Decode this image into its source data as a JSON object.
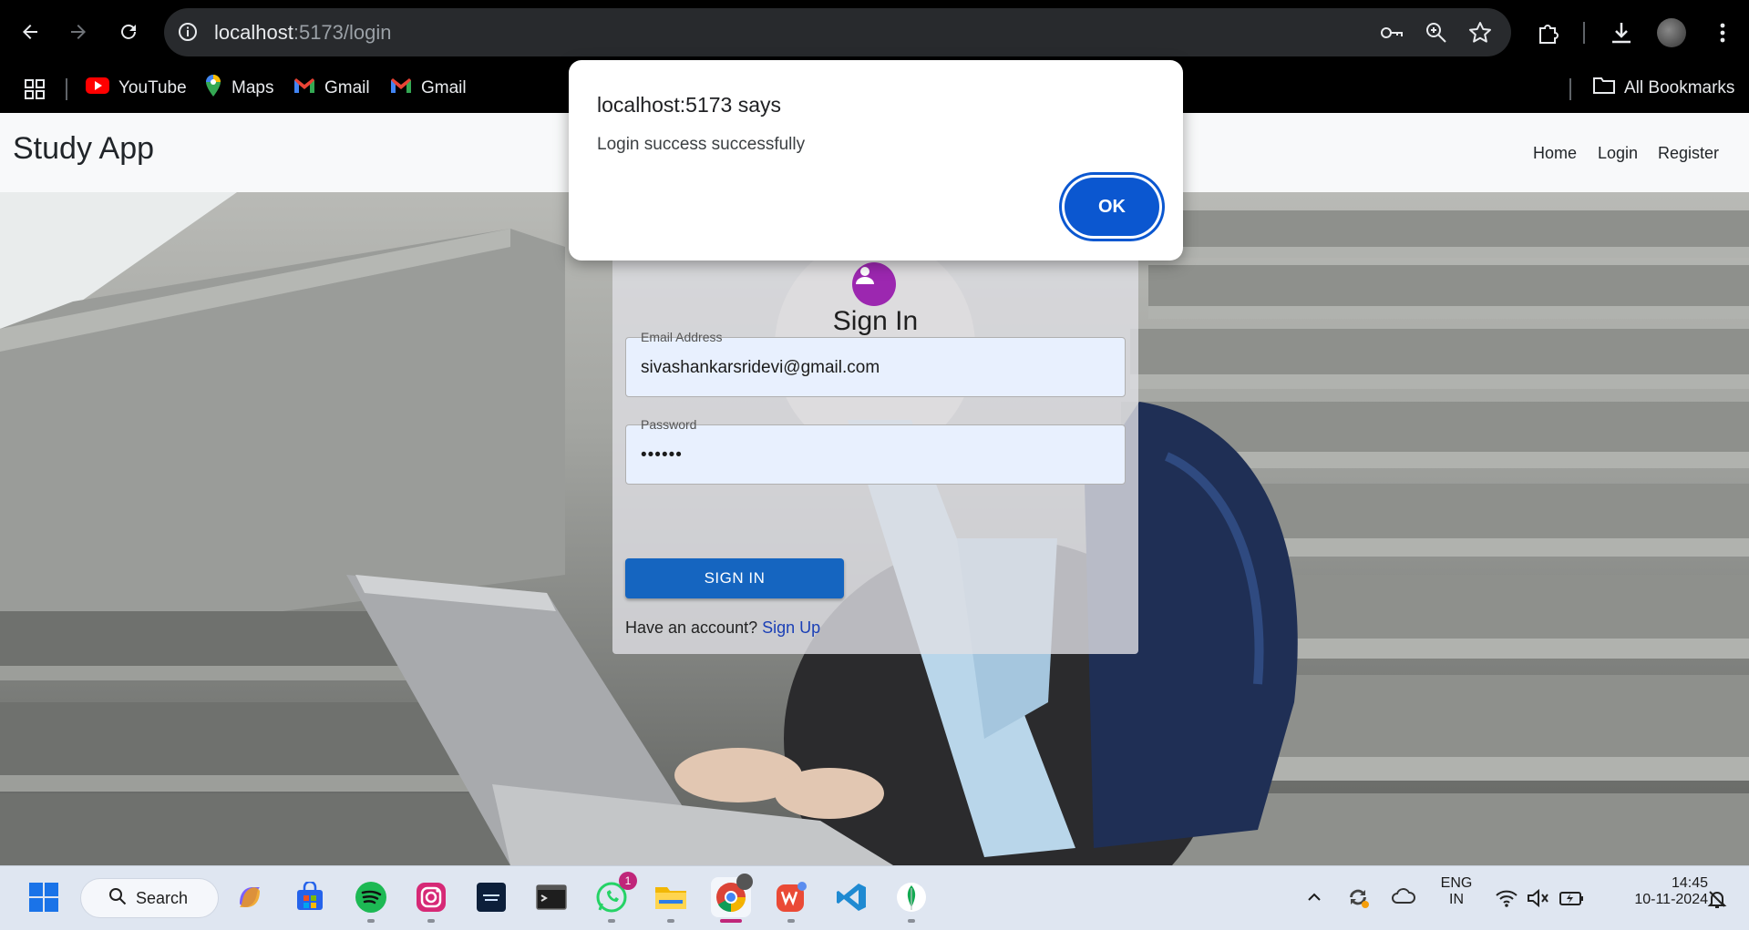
{
  "browser": {
    "url_host": "localhost",
    "url_rest": ":5173/login",
    "bookmarks": [
      {
        "label": "YouTube",
        "icon": "youtube-icon"
      },
      {
        "label": "Maps",
        "icon": "maps-icon"
      },
      {
        "label": "Gmail",
        "icon": "gmail-icon"
      },
      {
        "label": "Gmail",
        "icon": "gmail-icon"
      }
    ],
    "all_bookmarks": "All Bookmarks"
  },
  "app": {
    "brand": "Study App",
    "nav": [
      "Home",
      "Login",
      "Register"
    ]
  },
  "signin": {
    "title": "Sign In",
    "email_label": "Email Address",
    "email_value": "sivashankarsridevi@gmail.com",
    "password_label": "Password",
    "password_value": "••••••",
    "button": "SIGN IN",
    "have_account": "Have an account?",
    "signup_link": "Sign Up"
  },
  "dialog": {
    "title": "localhost:5173 says",
    "message": "Login success successfully",
    "ok": "OK"
  },
  "taskbar": {
    "search": "Search",
    "whatsapp_badge": "1",
    "lang_top": "ENG",
    "lang_bottom": "IN",
    "time": "14:45",
    "date": "10-11-2024"
  },
  "colors": {
    "accent": "#1565c0",
    "dialog_button": "#0b57d0",
    "avatar": "#9c27b0"
  }
}
